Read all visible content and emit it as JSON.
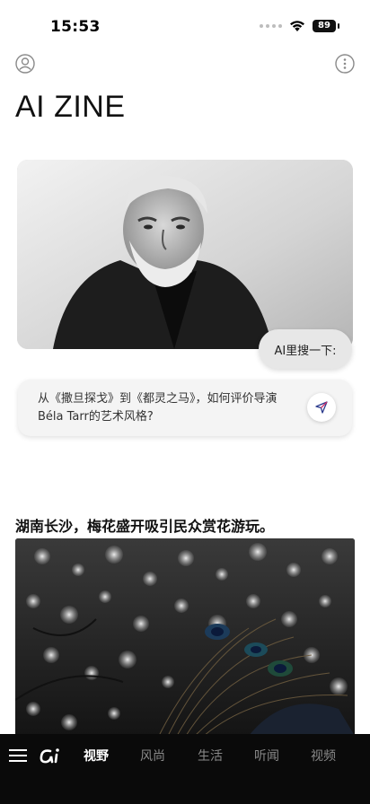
{
  "status_bar": {
    "time": "15:53",
    "battery": "89"
  },
  "header": {
    "brand": "AI ZINE"
  },
  "hero": {
    "ai_prompt_label": "AI里搜一下:"
  },
  "prompt": {
    "text": "从《撒旦探戈》到《都灵之马》，如何评价导演Béla Tarr的艺术风格?"
  },
  "news": {
    "title": "湖南长沙，梅花盛开吸引民众赏花游玩。"
  },
  "nav": {
    "tabs": [
      {
        "label": "视野",
        "active": true
      },
      {
        "label": "风尚"
      },
      {
        "label": "生活"
      },
      {
        "label": "听闻"
      },
      {
        "label": "视频"
      }
    ]
  },
  "icons": {
    "profile": "person-circle-icon",
    "more": "more-vertical-icon",
    "send": "send-icon",
    "menu": "hamburger-menu-icon",
    "logo": "app-logo-icon",
    "wifi": "wifi-icon"
  }
}
